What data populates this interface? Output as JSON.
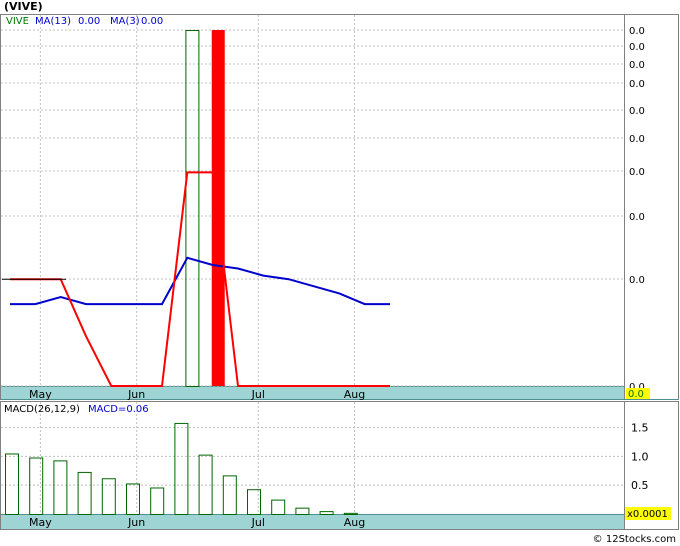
{
  "title": "(VIVE)",
  "colors": {
    "background": "#ffffff",
    "axis_strip": "#9fd4d4",
    "grid": "#c0c0c0",
    "price_line": "#ff0000",
    "ma13_line": "#0000cc",
    "volume_bar": "#006600",
    "highlight_bar": "#ff0000",
    "legend_green": "#007700",
    "legend_blue": "#0000cc",
    "last_value_box": "#ffff00",
    "last_value_text": "#007700"
  },
  "legend": {
    "ticker": "VIVE",
    "ma13": "MA(13)",
    "ma13_value": "0.00",
    "ma3": "MA(3)",
    "ma3_value": "0.00"
  },
  "price_axis_labels": [
    "0.0",
    "0.0",
    "0.0",
    "0.0",
    "0.0",
    "0.0",
    "0.0",
    "0.0",
    "0.0",
    "0.0"
  ],
  "price_last_value": "0.0",
  "month_labels": [
    "May",
    "Jun",
    "Jul",
    "Aug"
  ],
  "macd_legend": {
    "label": "MACD(26,12,9)",
    "value_label": "MACD=0.06"
  },
  "macd_axis_labels": [
    "1.5",
    "1.0",
    "0.5"
  ],
  "macd_multiplier": "x0.0001",
  "watermark": "© 12Stocks.com",
  "chart_data": [
    {
      "type": "line",
      "title": "(VIVE)",
      "x_index_range": [
        0,
        16
      ],
      "ylim": [
        0,
        1
      ],
      "grid": true,
      "series": [
        {
          "name": "VIVE",
          "kind": "line",
          "values": [
            0.3,
            0.3,
            0.3,
            0.14,
            0.0,
            0.0,
            0.0,
            0.6,
            0.6,
            0.0,
            0.0,
            0.0,
            0.0,
            0.0,
            0.0,
            0.0
          ]
        },
        {
          "name": "MA(13)",
          "kind": "line",
          "values": [
            0.23,
            0.23,
            0.25,
            0.23,
            0.23,
            0.23,
            0.23,
            0.36,
            0.34,
            0.33,
            0.31,
            0.3,
            0.28,
            0.26,
            0.23,
            0.23
          ]
        },
        {
          "name": "MA(3)",
          "kind": "line",
          "values": [
            0.3,
            0.3,
            0.3,
            0.14,
            0.0,
            0.0,
            0.0,
            0.6,
            0.6,
            0.0,
            0.0,
            0.0,
            0.0,
            0.0,
            0.0,
            0.0
          ]
        }
      ],
      "volume_bars": [
        {
          "x": 7.2,
          "value": 1.0,
          "color": "outline"
        },
        {
          "x": 8.2,
          "value": 1.0,
          "color": "filled"
        }
      ],
      "x_ticks": [
        {
          "label": "May",
          "x": 1.2
        },
        {
          "label": "Jun",
          "x": 5.0
        },
        {
          "label": "Jul",
          "x": 9.8
        },
        {
          "label": "Aug",
          "x": 13.6
        }
      ]
    },
    {
      "type": "bar",
      "title": "MACD(26,12,9)",
      "ylim": [
        0,
        1.7
      ],
      "grid": true,
      "categories": [
        "1",
        "2",
        "3",
        "4",
        "5",
        "6",
        "7",
        "8",
        "9",
        "10",
        "11",
        "12",
        "13",
        "14",
        "15"
      ],
      "values": [
        1.05,
        0.98,
        0.93,
        0.73,
        0.62,
        0.53,
        0.46,
        1.58,
        1.03,
        0.67,
        0.43,
        0.25,
        0.11,
        0.05,
        0.02
      ],
      "x_ticks": [
        {
          "label": "May",
          "x": 1.2
        },
        {
          "label": "Jun",
          "x": 5.0
        },
        {
          "label": "Jul",
          "x": 9.8
        },
        {
          "label": "Aug",
          "x": 13.6
        }
      ]
    }
  ]
}
